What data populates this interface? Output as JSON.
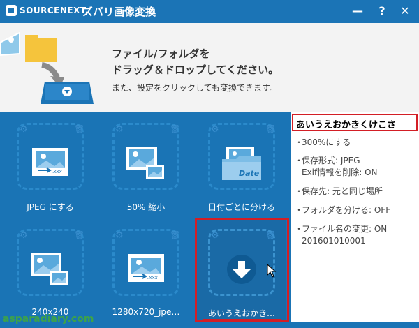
{
  "titlebar": {
    "brand": "SOURCENEXT.",
    "title": "ズバリ画像変換",
    "controls": {
      "minimize": "—",
      "help": "?",
      "close": "✕"
    }
  },
  "drop_area": {
    "line1": "ファイル/フォルダを",
    "line2": "ドラッグ＆ドロップしてください。",
    "line3": "また、設定をクリックしても変換できます。"
  },
  "tiles": [
    {
      "label": "JPEG にする",
      "icon": "jpeg-convert-icon",
      "badge": ".xxx"
    },
    {
      "label": "50% 縮小",
      "icon": "resize-icon"
    },
    {
      "label": "日付ごとに分ける",
      "icon": "date-folder-icon",
      "badge": "Date"
    },
    {
      "label": "240x240",
      "icon": "resize-icon"
    },
    {
      "label": "1280x720_jpe…",
      "icon": "jpeg-convert-icon",
      "badge": ".xxx"
    },
    {
      "label": "あいうえおかき…",
      "icon": "download-arrow-icon"
    }
  ],
  "panel": {
    "title": "あいうえおかきくけこさ",
    "bullet": "・",
    "items": [
      "300%にする",
      "保存形式: JPEG",
      "Exif情報を削除: ON",
      "保存先: 元と同じ場所",
      "フォルダを分ける: OFF",
      "ファイル名の変更: ON",
      "201601010001"
    ]
  },
  "watermark": "asparadiary.com",
  "colors": {
    "accent": "#1b74b6",
    "highlight": "#d31e25",
    "drop_bg": "#f3f3f3"
  }
}
